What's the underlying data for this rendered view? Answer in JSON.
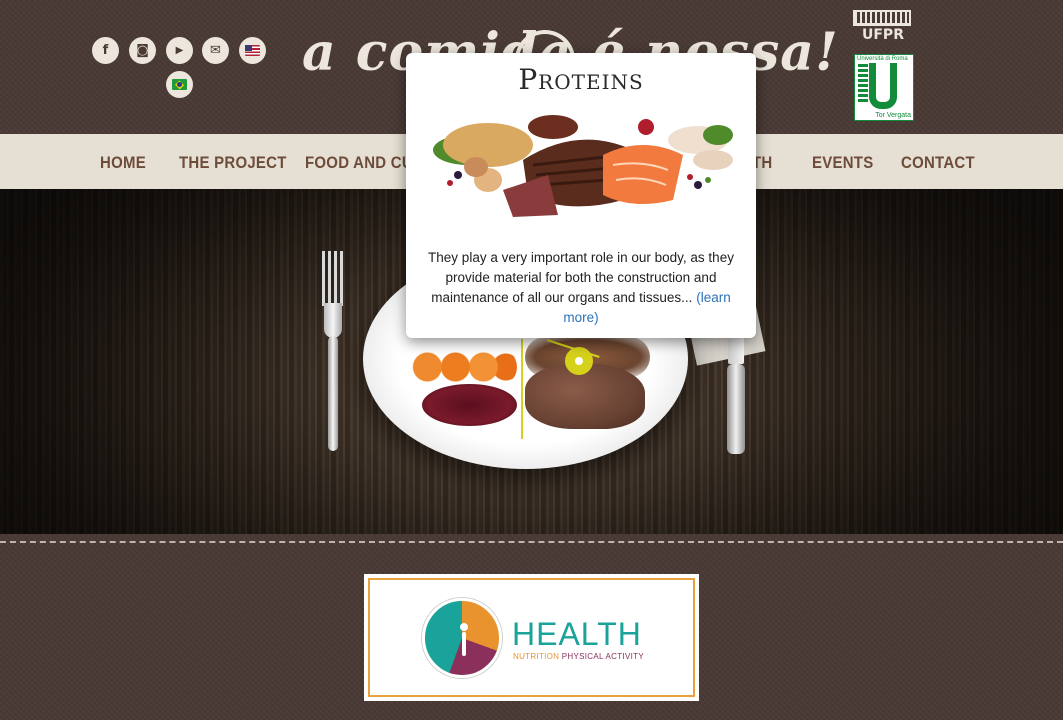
{
  "header": {
    "brand_title": "a comida é nossa!",
    "social_icons": [
      {
        "name": "facebook-icon",
        "glyph": "f"
      },
      {
        "name": "instagram-icon",
        "glyph": "◙"
      },
      {
        "name": "youtube-icon",
        "glyph": "▶"
      },
      {
        "name": "email-icon",
        "glyph": "✉"
      }
    ],
    "languages": [
      "english-flag-icon",
      "portuguese-flag-icon"
    ],
    "partner_logos": {
      "ufpr": "UFPR",
      "tor_vergata_top": "Università di Roma",
      "tor_vergata_bottom": "Tor Vergata"
    }
  },
  "nav": {
    "items": [
      "HOME",
      "THE PROJECT",
      "FOOD AND CULT",
      "TH",
      "EVENTS",
      "CONTACT"
    ]
  },
  "popup": {
    "title": "Proteins",
    "text": "They play a very important role in our body, as they provide material for both the construction and maintenance of all our organs and tissues...",
    "link": "(learn more)",
    "image_alt": "proteins-food-image"
  },
  "health_banner": {
    "title": "HEALTH",
    "sub_nutrition": "NUTRITION",
    "sub_activity": "PHYSICAL ACTIVITY"
  },
  "colors": {
    "background": "#4a3a35",
    "nav_background": "#e6dfd3",
    "nav_text": "#6d4c39",
    "hotspot": "#d6d21b",
    "link": "#2a72b8",
    "health_teal": "#1aa39a",
    "health_orange": "#e8932e",
    "health_purple": "#8b2f5b"
  }
}
